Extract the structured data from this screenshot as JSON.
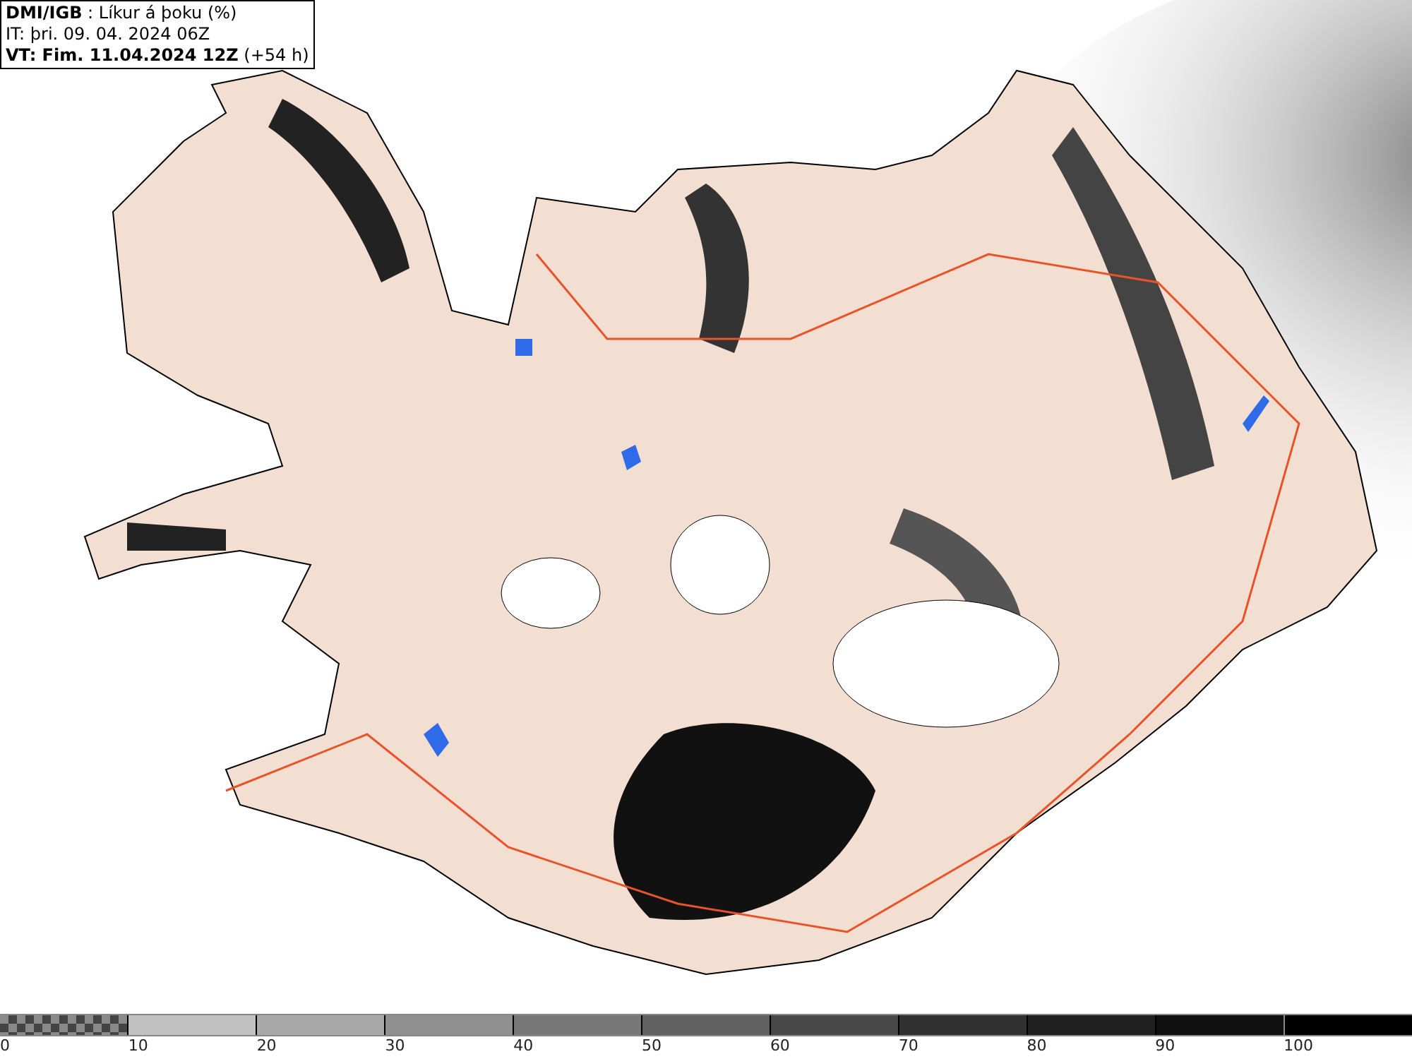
{
  "header": {
    "lines": [
      "**DMI/IGB** : Líkur á þoku (%)",
      "IT: þri. 09. 04. 2024 06Z",
      "**VT: Fim. 11.04.2024 12Z** (+54 h)"
    ]
  },
  "legend": {
    "segments": [
      {
        "kind": "checker",
        "label": "0"
      },
      {
        "kind": "solid",
        "color": "#c0c0c0",
        "label": "10"
      },
      {
        "kind": "solid",
        "color": "#a8a8a8",
        "label": "20"
      },
      {
        "kind": "solid",
        "color": "#909090",
        "label": "30"
      },
      {
        "kind": "solid",
        "color": "#787878",
        "label": "40"
      },
      {
        "kind": "solid",
        "color": "#606060",
        "label": "50"
      },
      {
        "kind": "solid",
        "color": "#484848",
        "label": "60"
      },
      {
        "kind": "solid",
        "color": "#303030",
        "label": "70"
      },
      {
        "kind": "solid",
        "color": "#202020",
        "label": "80"
      },
      {
        "kind": "solid",
        "color": "#101010",
        "label": "90"
      },
      {
        "kind": "solid",
        "color": "#000000",
        "label": "100"
      }
    ]
  }
}
